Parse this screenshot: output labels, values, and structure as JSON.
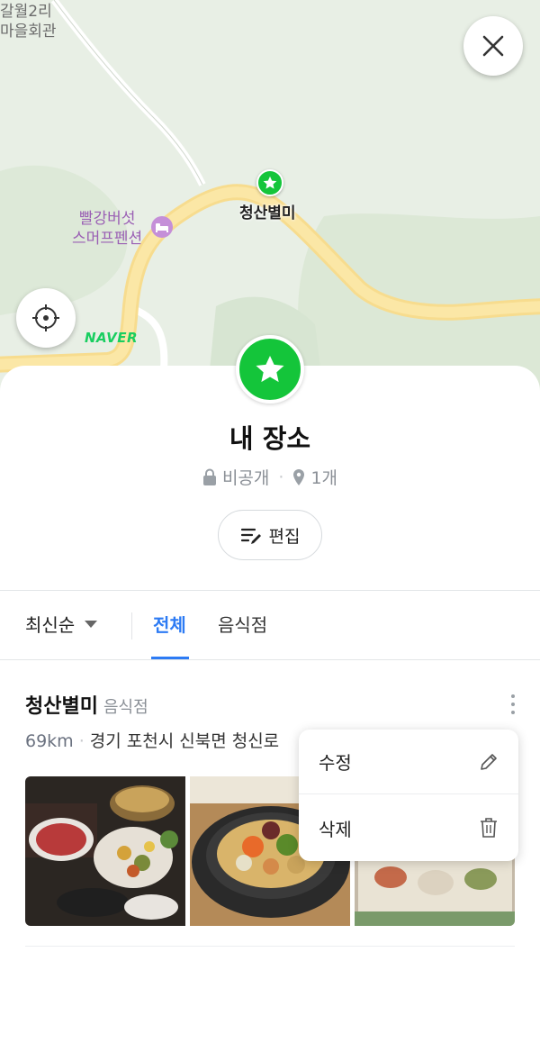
{
  "map": {
    "labels": {
      "village_line1": "갈월2리",
      "village_line2": "마을회관",
      "pension_line1": "빨강버섯",
      "pension_line2": "스머프펜션",
      "saved_place": "청산별미"
    },
    "logo_text": "NAVER",
    "icons": {
      "close": "close-icon",
      "locate": "crosshair-icon",
      "pin": "star-icon",
      "hotel": "bed-icon"
    }
  },
  "folder": {
    "title": "내 장소",
    "visibility": "비공개",
    "count": "1개",
    "edit_label": "편집",
    "badge_color": "#14c53a"
  },
  "filters": {
    "sort_label": "최신순",
    "tabs": [
      {
        "label": "전체",
        "active": true
      },
      {
        "label": "음식점",
        "active": false
      }
    ],
    "accent_color": "#2d7bf4"
  },
  "place": {
    "name": "청산별미",
    "category": "음식점",
    "distance": "69km",
    "address": "경기 포천시 신북면 청신로"
  },
  "context_menu": {
    "items": [
      {
        "label": "수정",
        "icon": "pencil-icon"
      },
      {
        "label": "삭제",
        "icon": "trash-icon"
      }
    ]
  }
}
